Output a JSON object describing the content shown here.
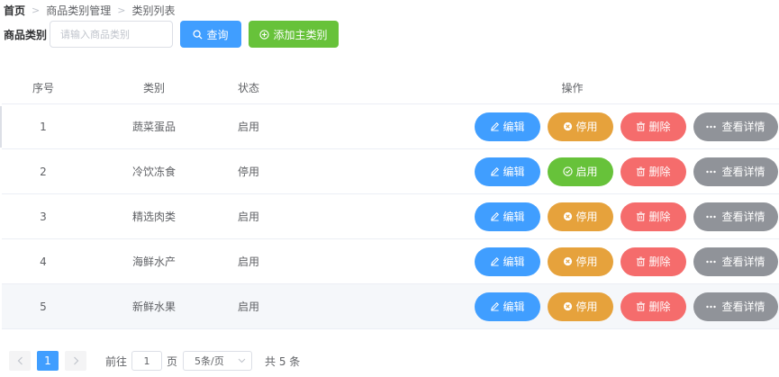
{
  "breadcrumb": {
    "home": "首页",
    "level2": "商品类别管理",
    "level3": "类别列表",
    "separator": ">"
  },
  "search": {
    "label": "商品类别",
    "placeholder": "请输入商品类别",
    "value": "",
    "query_label": "查询",
    "add_label": "添加主类别"
  },
  "table": {
    "headers": {
      "index": "序号",
      "category": "类别",
      "status": "状态",
      "actions": "操作"
    },
    "rows": [
      {
        "index": "1",
        "category": "蔬菜蛋品",
        "status": "启用",
        "toggle_label": "停用"
      },
      {
        "index": "2",
        "category": "冷饮冻食",
        "status": "停用",
        "toggle_label": "启用"
      },
      {
        "index": "3",
        "category": "精选肉类",
        "status": "启用",
        "toggle_label": "停用"
      },
      {
        "index": "4",
        "category": "海鲜水产",
        "status": "启用",
        "toggle_label": "停用"
      },
      {
        "index": "5",
        "category": "新鲜水果",
        "status": "启用",
        "toggle_label": "停用"
      }
    ],
    "action_labels": {
      "edit": "编辑",
      "delete": "删除",
      "detail": "查看详情"
    }
  },
  "pagination": {
    "prev": "<",
    "next": ">",
    "current_page": "1",
    "goto_prefix": "前往",
    "goto_value": "1",
    "goto_suffix": "页",
    "page_size": "5条/页",
    "total": "共 5 条"
  },
  "colors": {
    "primary": "#409eff",
    "success": "#67c23a",
    "warning": "#e6a23c",
    "danger": "#f56c6c",
    "info": "#909399"
  }
}
